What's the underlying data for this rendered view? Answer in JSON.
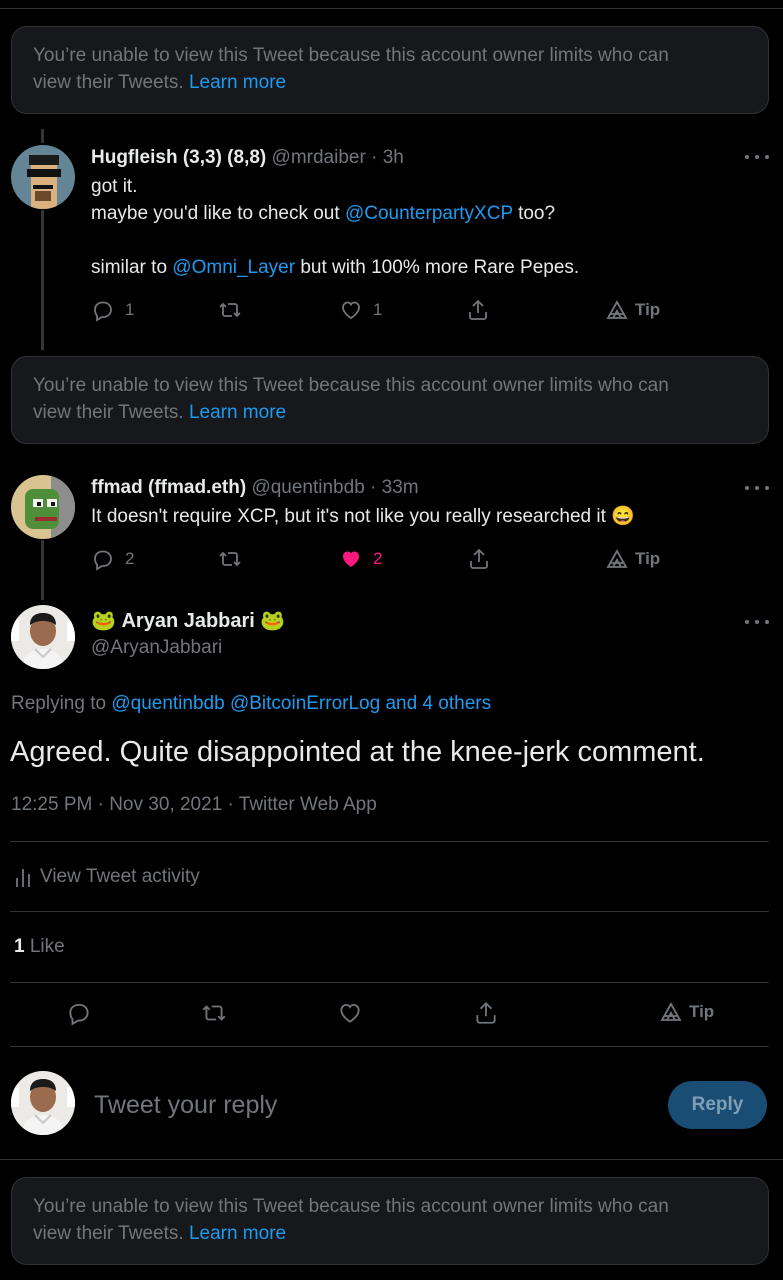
{
  "notice": {
    "text": "You’re unable to view this Tweet because this account owner limits who can view their Tweets.",
    "line1": "You’re unable to view this Tweet because this account owner limits who can",
    "line2": "view their Tweets.",
    "link": "Learn more"
  },
  "tweets": [
    {
      "name": "Hugfleish (3,3) (8,8)",
      "handle": "@mrdaiber",
      "sep": "·",
      "time": "3h",
      "lines": [
        "got it.",
        "maybe you'd like to check out",
        "@CounterpartyXCP",
        "too?",
        "similar to",
        "@Omni_Layer",
        "but with 100% more Rare Pepes."
      ],
      "replies": "1",
      "retweets": "",
      "likes": "1",
      "tip": "Tip"
    },
    {
      "name": "ffmad (ffmad.eth)",
      "handle": "@quentinbdb",
      "sep": "·",
      "time": "33m",
      "text": "It doesn't require XCP, but it's not like you really researched it",
      "emoji": "😄",
      "replies": "2",
      "retweets": "",
      "likes": "2",
      "tip": "Tip"
    }
  ],
  "main": {
    "name": "Aryan Jabbari",
    "emoji": "🐸",
    "handle": "@AryanJabbari",
    "replying_prefix": "Replying to",
    "replying_mentions": "@quentinbdb @BitcoinErrorLog and 4 others",
    "text": "Agreed. Quite disappointed at the knee-jerk comment.",
    "meta": "12:25 PM · Nov 30, 2021 · Twitter Web App",
    "activity": "View Tweet activity",
    "likes_count": "1",
    "likes_label": "Like",
    "tip": "Tip"
  },
  "composer": {
    "placeholder": "Tweet your reply",
    "button": "Reply"
  },
  "colors": {
    "background": "#000000",
    "accent": "#1d9bf0",
    "like": "#f91880",
    "muted": "#71767b"
  }
}
